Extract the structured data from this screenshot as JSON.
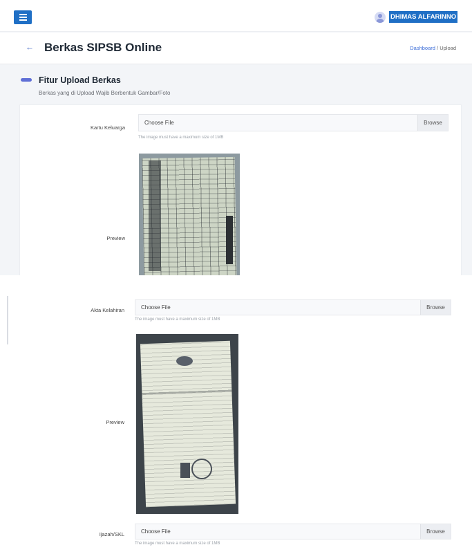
{
  "header": {
    "username": "DHIMAS ALFARINNO",
    "menu_icon": "hamburger-icon",
    "avatar_icon": "user-avatar-icon"
  },
  "page": {
    "title": "Berkas SIPSB Online",
    "back_icon": "arrow-left-icon",
    "breadcrumb": {
      "home": "Dashboard",
      "separator": "/",
      "current": "Upload"
    }
  },
  "section": {
    "title": "Fitur Upload Berkas",
    "description": "Berkas yang di Upload Wajib Berbentuk Gambar/Foto"
  },
  "fields": {
    "kartu_keluarga": {
      "label": "Kartu Keluarga",
      "placeholder": "Choose File",
      "browse": "Browse",
      "hint": "The image must have a maximum size of 1MB",
      "preview_label": "Preview"
    },
    "akta_kelahiran": {
      "label": "Akta Kelahiran",
      "placeholder": "Choose File",
      "browse": "Browse",
      "hint": "The image must have a maximum size of 1MB",
      "preview_label": "Preview"
    },
    "ijazah_skl": {
      "label": "Ijazah/SKL",
      "placeholder": "Choose File",
      "browse": "Browse",
      "hint": "The image must have a maximum size of 1MB"
    }
  },
  "colors": {
    "primary": "#1f6fc5",
    "accent": "#5f6fd6",
    "background": "#f3f5f8"
  }
}
